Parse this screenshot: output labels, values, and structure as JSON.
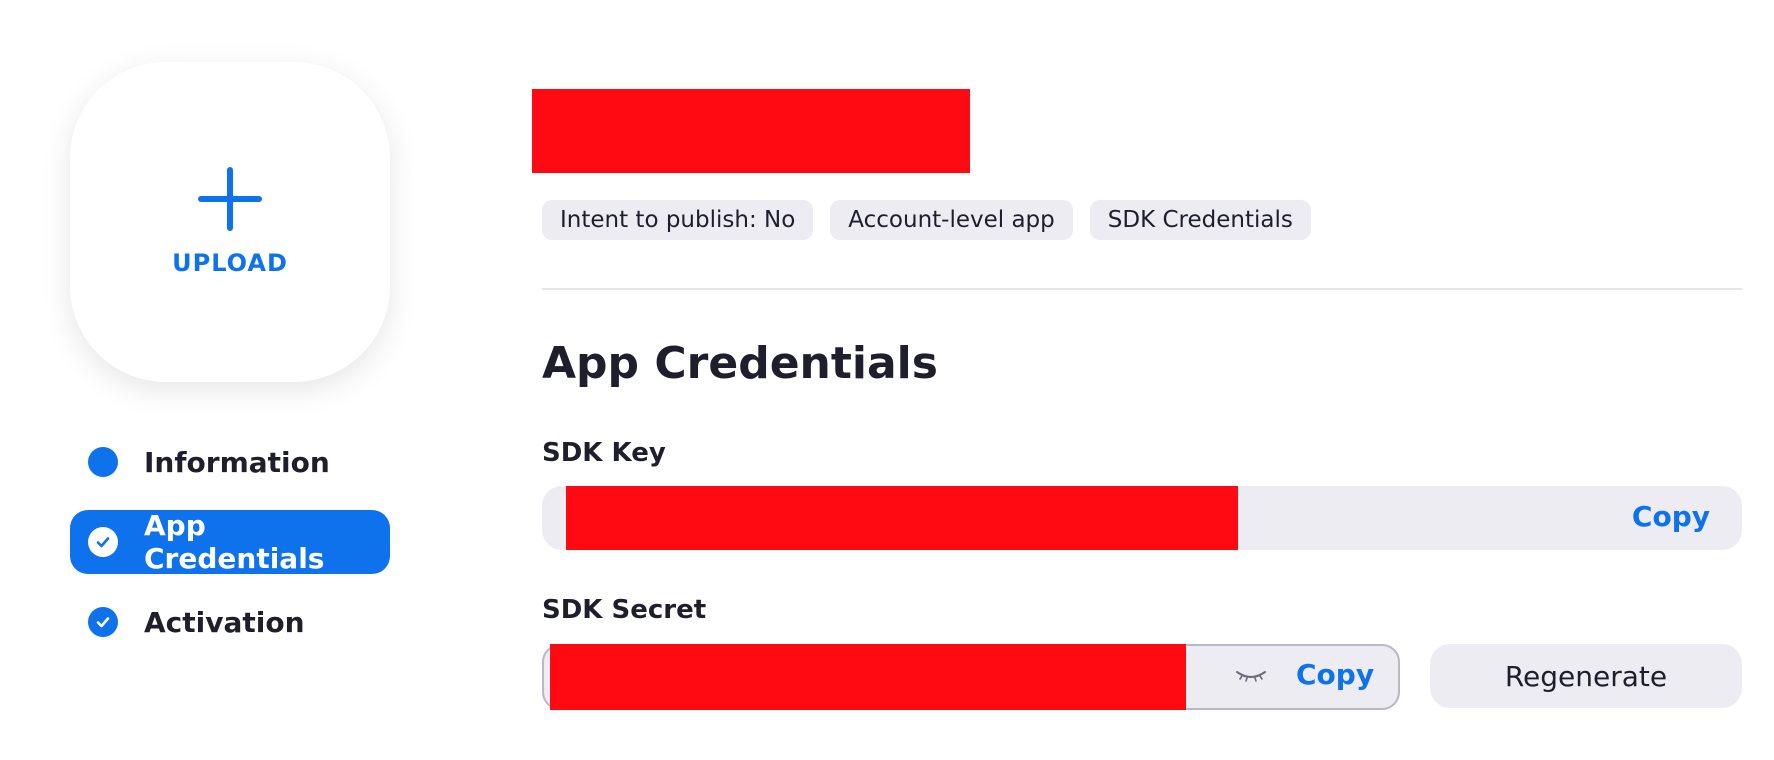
{
  "upload": {
    "label": "UPLOAD",
    "icon": "plus-icon"
  },
  "nav": {
    "items": [
      {
        "label": "Information",
        "icon": "dot-icon",
        "active": false
      },
      {
        "label": "App Credentials",
        "icon": "check-circle-icon",
        "active": true
      },
      {
        "label": "Activation",
        "icon": "check-circle-icon",
        "active": false
      }
    ]
  },
  "tags": [
    "Intent to publish: No",
    "Account-level app",
    "SDK Credentials"
  ],
  "section": {
    "title": "App Credentials"
  },
  "sdk_key": {
    "label": "SDK Key",
    "copy_label": "Copy"
  },
  "sdk_secret": {
    "label": "SDK Secret",
    "copy_label": "Copy",
    "toggle_icon": "eye-closed-icon",
    "regenerate_label": "Regenerate"
  },
  "colors": {
    "accent": "#0e72ed",
    "redaction": "#ff0a12",
    "field_bg": "#ececf2"
  }
}
